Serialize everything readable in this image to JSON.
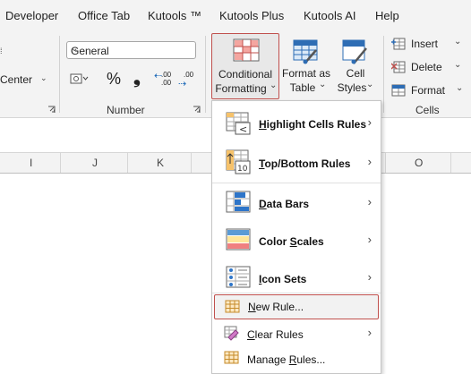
{
  "menu_tabs": [
    "Developer",
    "Office Tab",
    "Kutools ™",
    "Kutools Plus",
    "Kutools AI",
    "Help"
  ],
  "ribbon": {
    "alignment": {
      "center_label": "Center"
    },
    "number": {
      "format_value": "General",
      "percent_symbol": "%",
      "comma_symbol": "❟",
      "inc_decimal": ".00",
      "dec_decimal": ".00",
      "group_label": "Number"
    },
    "styles": {
      "conditional_formatting": [
        "Conditional",
        "Formatting"
      ],
      "format_as_table": [
        "Format as",
        "Table"
      ],
      "cell_styles": [
        "Cell",
        "Styles"
      ]
    },
    "cells": {
      "insert": "Insert",
      "delete": "Delete",
      "format": "Format",
      "group_label": "Cells"
    }
  },
  "columns": [
    "I",
    "J",
    "K",
    "O"
  ],
  "dropdown": {
    "items": [
      {
        "key": "H",
        "rest": "ighlight Cells Rules",
        "submenu": true
      },
      {
        "key": "T",
        "rest": "op/Bottom Rules",
        "submenu": true
      },
      {
        "key": "D",
        "rest": "ata Bars",
        "submenu": true
      },
      {
        "key": "S",
        "pre": "Color ",
        "rest": "cales",
        "submenu": true
      },
      {
        "key": "I",
        "rest": "con Sets",
        "submenu": true
      }
    ],
    "new_rule": {
      "key": "N",
      "rest": "ew Rule..."
    },
    "clear_rules": {
      "key": "C",
      "rest": "lear Rules"
    },
    "manage_rules": {
      "pre": "Manage ",
      "key": "R",
      "rest": "ules..."
    }
  }
}
